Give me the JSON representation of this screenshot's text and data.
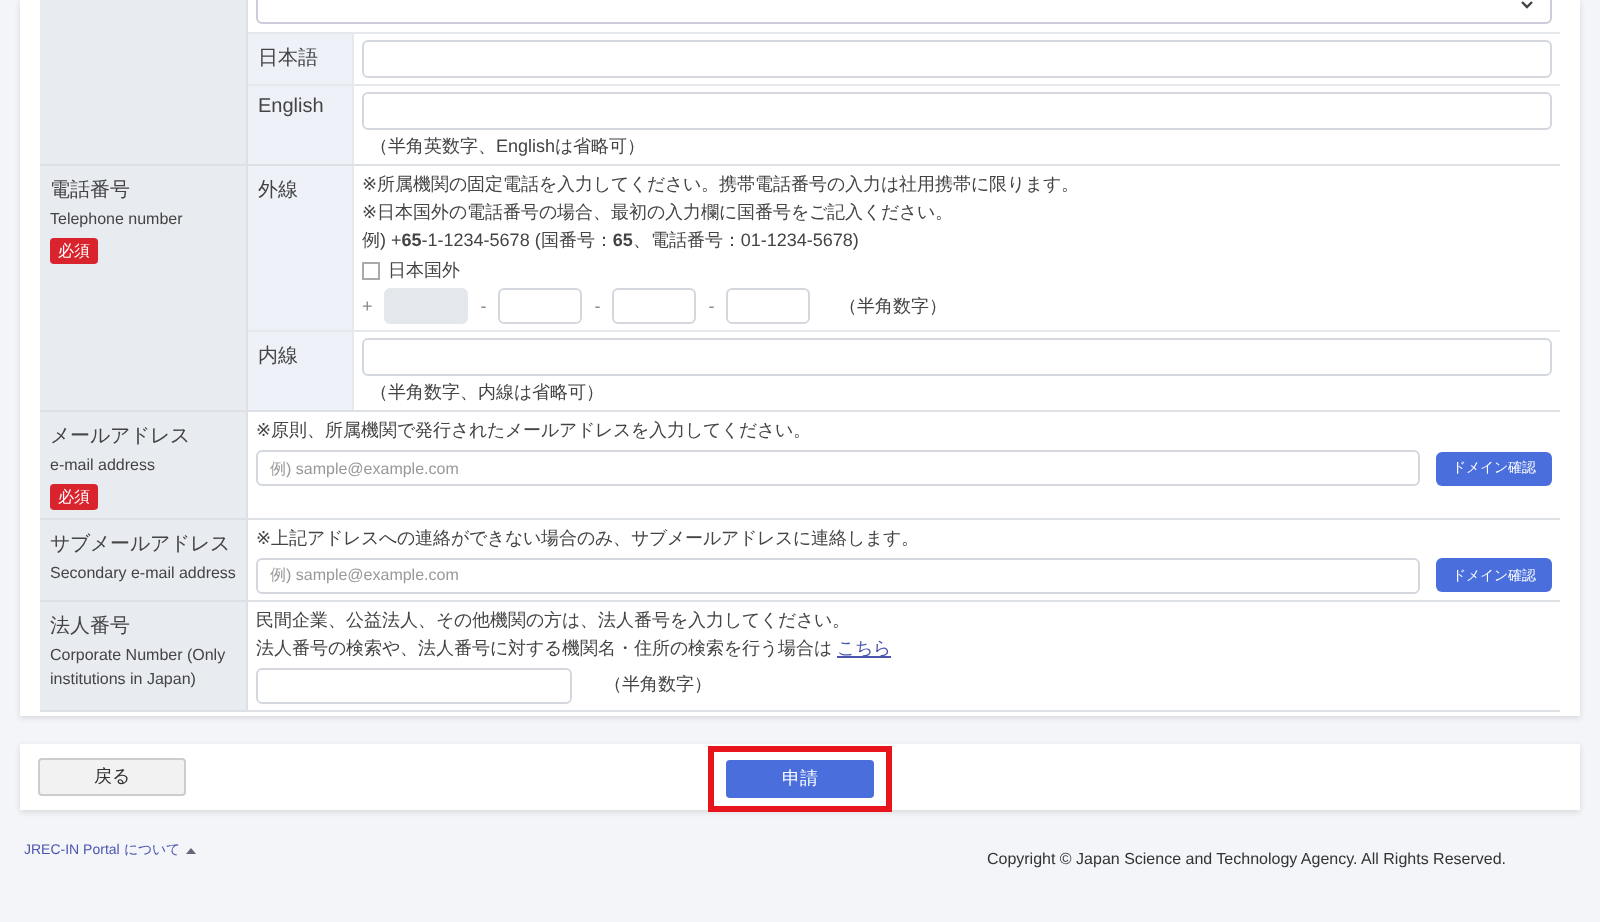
{
  "form": {
    "sections": [
      {
        "required": false,
        "rows": [
          {
            "kind": "select"
          },
          {
            "kind": "text",
            "sublabel": "日本語"
          },
          {
            "kind": "text",
            "sublabel": "English",
            "note": "（半角英数字、Englishは省略可）"
          }
        ]
      },
      {
        "label": "電話番号",
        "label_en": "Telephone number",
        "required": true,
        "required_label": "必須",
        "rows": [
          {
            "kind": "phone",
            "sublabel": "外線",
            "lines": [
              "※所属機関の固定電話を入力してください。携帯電話番号の入力は社用携帯に限ります。",
              "※日本国外の電話番号の場合、最初の入力欄に国番号をご記入ください。",
              "例) +**65**-1-1234-5678 (国番号：**65**、電話番号：01-1234-5678)"
            ],
            "overseas": {
              "label": "日本国外",
              "checked": false
            },
            "fields": [
              {
                "prefix": "+",
                "disabled": true
              },
              {
                "prefix": "-",
                "disabled": false
              },
              {
                "prefix": "-",
                "disabled": false
              },
              {
                "prefix": "-",
                "disabled": false
              }
            ],
            "note": "（半角数字）"
          },
          {
            "kind": "text",
            "sublabel": "内線",
            "note": "（半角数字、内線は省略可）"
          }
        ]
      },
      {
        "label": "メールアドレス",
        "label_en": "e-mail address",
        "required": true,
        "required_label": "必須",
        "rows": [
          {
            "kind": "email",
            "lines": [
              "※原則、所属機関で発行されたメールアドレスを入力してください。"
            ],
            "placeholder": "例) sample@example.com",
            "button": "ドメイン確認"
          }
        ]
      },
      {
        "label": "サブメールアドレス",
        "label_en": "Secondary e-mail address",
        "required": false,
        "rows": [
          {
            "kind": "email",
            "lines": [
              "※上記アドレスへの連絡ができない場合のみ、サブメールアドレスに連絡します。"
            ],
            "placeholder": "例) sample@example.com",
            "button": "ドメイン確認"
          }
        ]
      },
      {
        "label": "法人番号",
        "label_en": "Corporate Number (Only institutions in Japan)",
        "required": false,
        "rows": [
          {
            "kind": "corp",
            "lines": [
              "民間企業、公益法人、その他機関の方は、法人番号を入力してください。"
            ],
            "link_line": {
              "text": "法人番号の検索や、法人番号に対する機関名・住所の検索を行う場合は",
              "link": "こちら"
            },
            "note": "（半角数字）"
          }
        ]
      }
    ]
  },
  "actions": {
    "back": "戻る",
    "submit": {
      "label": "申請",
      "highlighted": true
    }
  },
  "footer": {
    "link": "JREC-IN Portal について",
    "copyright": "Copyright © Japan Science and Technology Agency. All Rights Reserved."
  }
}
